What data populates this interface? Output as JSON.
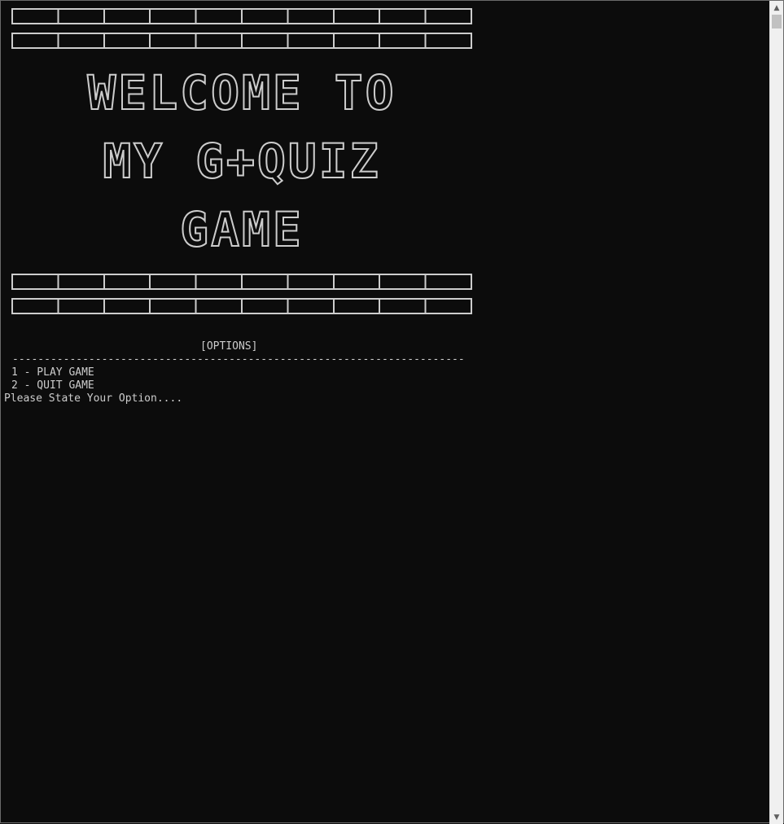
{
  "banner": {
    "title_lines": [
      "WELCOME TO",
      "MY G+QUIZ",
      "GAME"
    ]
  },
  "menu": {
    "options_header": "[OPTIONS]",
    "rule": "-----------------------------------------------------------------------",
    "options": [
      {
        "label": "1 - PLAY GAME"
      },
      {
        "label": "2 - QUIT GAME"
      }
    ],
    "prompt": "Please State Your Option...."
  },
  "scrollbar": {
    "up_icon": "chevron-up-icon",
    "down_icon": "chevron-down-icon"
  },
  "colors": {
    "background": "#0c0c0c",
    "foreground": "#cccccc",
    "scrollbar": "#f0f0f0"
  }
}
